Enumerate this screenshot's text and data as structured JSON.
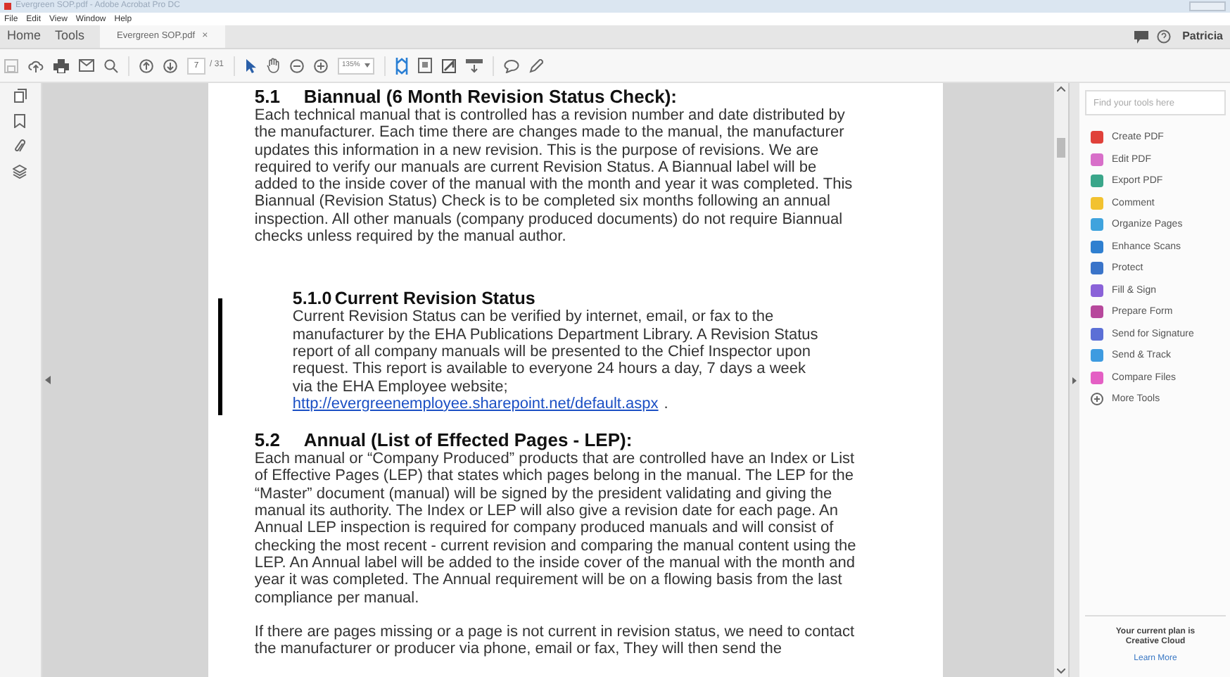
{
  "window": {
    "title": "Evergreen SOP.pdf - Adobe Acrobat Pro DC"
  },
  "menu": [
    "File",
    "Edit",
    "View",
    "Window",
    "Help"
  ],
  "tabs": [
    {
      "label": "Home",
      "selected": false
    },
    {
      "label": "Tools",
      "selected": false
    },
    {
      "label": "Evergreen SOP.pdf",
      "selected": true,
      "close": "×"
    }
  ],
  "user": "Patricia",
  "toolbar": {
    "page": "7",
    "page_count": "/ 31",
    "zoom": "135%"
  },
  "document": [
    {
      "kind": "heading",
      "number": "5.1",
      "text": "Biannual (6 Month Revision Status Check):"
    },
    {
      "kind": "para",
      "text": "Each technical manual that is controlled has a revision number and date distributed by the manufacturer. Each time there are changes made to the manual, the manufacturer updates this information in a new revision. This is the purpose of revisions. We are required to verify our manuals are current Revision Status. A Biannual label will be added to the inside cover of the manual with the month and year it was completed. This Biannual (Revision Status) Check is to be completed six months following an annual inspection. All other manuals (company produced documents) do not require Biannual checks unless required by the manual author."
    },
    {
      "kind": "subheading",
      "number": "5.1.0",
      "text": "Current Revision Status",
      "changed": true
    },
    {
      "kind": "subpara",
      "text": "Current Revision Status can be verified by internet, email, or fax to the manufacturer by the EHA Publications Department Library. A Revision Status report of all company manuals will be presented to the Chief Inspector upon request. This report is available to everyone 24 hours a day, 7 days a week via the EHA Employee website;",
      "link": "http://evergreenemployee.sharepoint.net/default.aspx",
      "after": "."
    },
    {
      "kind": "heading",
      "number": "5.2",
      "text": "Annual (List of Effected Pages - LEP):"
    },
    {
      "kind": "para",
      "text": "Each manual or “Company Produced” products that are controlled have an Index or List of Effective Pages (LEP) that states which pages belong in the manual. The LEP for the “Master” document (manual) will be signed by the president validating and giving the manual its authority. The Index or LEP will also give a revision date for each page. An Annual LEP inspection is required for company produced manuals and will consist of checking the most recent - current revision and comparing the manual content using the LEP. An Annual label will be added to the inside cover of the manual with the month and year it was completed. The Annual requirement will be on a flowing basis from the last compliance per manual."
    },
    {
      "kind": "para",
      "text": "If there are pages missing or a page is not current in revision status, we need to contact the manufacturer or producer via phone, email or fax, They will then send the"
    }
  ],
  "tools_panel": {
    "search": {
      "placeholder": "Find your tools here"
    },
    "tools": [
      {
        "label": "Create PDF",
        "color": "#e0413a"
      },
      {
        "label": "Edit PDF",
        "color": "#d86fc9"
      },
      {
        "label": "Export PDF",
        "color": "#3aa68a"
      },
      {
        "label": "Comment",
        "color": "#f2c230"
      },
      {
        "label": "Organize Pages",
        "color": "#3fa3dd"
      },
      {
        "label": "Enhance Scans",
        "color": "#2f7fd0"
      },
      {
        "label": "Protect",
        "color": "#3a74c9"
      },
      {
        "label": "Fill & Sign",
        "color": "#8a62d8"
      },
      {
        "label": "Prepare Form",
        "color": "#b7489c"
      },
      {
        "label": "Send for Signature",
        "color": "#5b6fd6"
      },
      {
        "label": "Send & Track",
        "color": "#3e9be0"
      },
      {
        "label": "Compare Files",
        "color": "#e45fc4"
      }
    ],
    "more": "More Tools",
    "plan": "Your current plan is Creative Cloud",
    "learn_more": "Learn More"
  }
}
